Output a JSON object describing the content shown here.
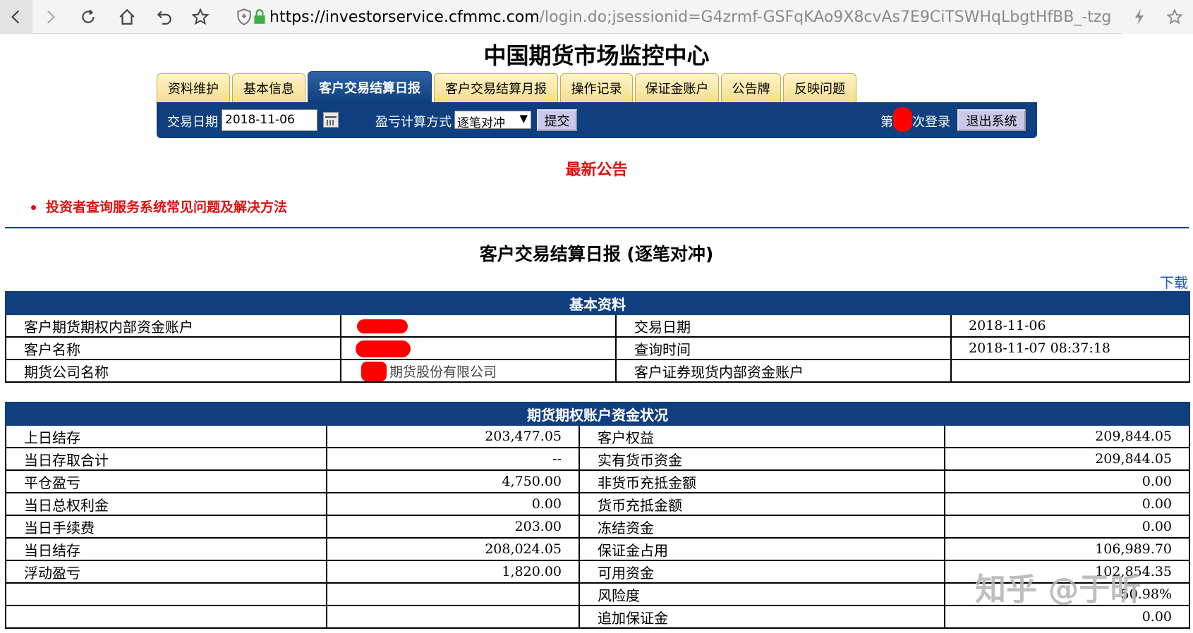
{
  "browser": {
    "url_host": "https://investorservice.cfmmc.com",
    "url_path": "/login.do;jsessionid=G4zrmf-GSFqKAo9X8cvAs7E9CiTSWHqLbgtHfBB_-tzg"
  },
  "site_title": "中国期货市场监控中心",
  "tabs": [
    "资料维护",
    "基本信息",
    "客户交易结算日报",
    "客户交易结算月报",
    "操作记录",
    "保证金账户",
    "公告牌",
    "反映问题"
  ],
  "toolbar": {
    "date_label": "交易日期",
    "date_value": "2018-11-06",
    "calc_label": "盈亏计算方式",
    "calc_value": "逐笔对冲",
    "submit_label": "提交",
    "login_prefix": "第",
    "login_suffix": "次登录",
    "logout_label": "退出系统"
  },
  "notice": {
    "title": "最新公告",
    "item": "投资者查询服务系统常见问题及解决方法"
  },
  "report_title": "客户交易结算日报 (逐笔对冲)",
  "download_label": "下载",
  "basic": {
    "header": "基本资料",
    "rows": [
      {
        "l1": "客户期货期权内部资金账户",
        "v1": "",
        "l2": "交易日期",
        "v2": "2018-11-06"
      },
      {
        "l1": "客户名称",
        "v1": "",
        "l2": "查询时间",
        "v2": "2018-11-07 08:37:18"
      },
      {
        "l1": "期货公司名称",
        "v1": "期货股份有限公司",
        "l2": "客户证券现货内部资金账户",
        "v2": ""
      }
    ]
  },
  "funds": {
    "header": "期货期权账户资金状况",
    "rows": [
      {
        "l1": "上日结存",
        "v1": "203,477.05",
        "l2": "客户权益",
        "v2": "209,844.05"
      },
      {
        "l1": "当日存取合计",
        "v1": "--",
        "l2": "实有货币资金",
        "v2": "209,844.05"
      },
      {
        "l1": "平仓盈亏",
        "v1": "4,750.00",
        "l2": "非货币充抵金额",
        "v2": "0.00"
      },
      {
        "l1": "当日总权利金",
        "v1": "0.00",
        "l2": "货币充抵金额",
        "v2": "0.00"
      },
      {
        "l1": "当日手续费",
        "v1": "203.00",
        "l2": "冻结资金",
        "v2": "0.00"
      },
      {
        "l1": "当日结存",
        "v1": "208,024.05",
        "l2": "保证金占用",
        "v2": "106,989.70"
      },
      {
        "l1": "浮动盈亏",
        "v1": "1,820.00",
        "l2": "可用资金",
        "v2": "102,854.35"
      },
      {
        "l1": "",
        "v1": "",
        "l2": "风险度",
        "v2": "50.98%"
      },
      {
        "l1": "",
        "v1": "",
        "l2": "追加保证金",
        "v2": "0.00"
      }
    ]
  },
  "watermark": "知乎 @于昕"
}
